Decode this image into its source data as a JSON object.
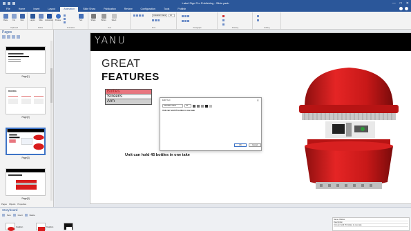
{
  "window": {
    "title": "Label Sign Pro Publishing - Slide.yanb",
    "controls": [
      "—",
      "□",
      "✕"
    ]
  },
  "menu": {
    "tabs": [
      "File",
      "Home",
      "Insert",
      "Layout",
      "Animation",
      "Slide Show",
      "Publication",
      "Review",
      "Configuration",
      "Tools",
      "Publish"
    ],
    "active_index": 4
  },
  "ribbon": {
    "buttons": [
      "Paste",
      "Cut",
      "New",
      "Layout",
      "Slide",
      "Animations",
      "Preview",
      "Text",
      "Shape",
      "Picture",
      "Select"
    ],
    "font_name": "Liberation Sans",
    "font_size": "12",
    "groups": [
      "Clipboard",
      "Slides",
      "Animation",
      "Text",
      "Font",
      "Paragraph",
      "Drawing",
      "Editing"
    ]
  },
  "pages": {
    "title": "Pages",
    "items": [
      {
        "label": "Page[1]"
      },
      {
        "label": "Page[2]"
      },
      {
        "label": "Page[3]"
      },
      {
        "label": "Page[4]"
      }
    ],
    "selected_index": 2,
    "thumb2_title": "RAKING",
    "panel_tabs": [
      "Pages",
      "Objects",
      "Properties"
    ]
  },
  "slide": {
    "logo": "YANU",
    "heading_line1": "GREAT",
    "heading_line2": "FEATURES",
    "list": [
      "Bottles",
      "Screens",
      "Arm"
    ],
    "caption": "Unit can hold 45 bottles in one take"
  },
  "dialog": {
    "title": "Edit Text",
    "font": "Liberation Sans",
    "size": "12",
    "text": "Unit can hold 45 bottles in one take",
    "ok_label": "OK",
    "cancel_label": "Cancel",
    "close": "✕"
  },
  "storyboard": {
    "title": "Storyboard",
    "tool_labels": [
      "New",
      "Insert",
      "Delete"
    ],
    "items": [
      {
        "label": "Caption"
      },
      {
        "label": "Caption"
      }
    ],
    "right_panel_rows": [
      "Name: Bottles",
      "Description",
      "Unit can hold 45 bottles in one take"
    ]
  },
  "colors": {
    "accent": "#2b579a",
    "product_red": "#d81b1b",
    "list_highlight": "#e8767f"
  }
}
